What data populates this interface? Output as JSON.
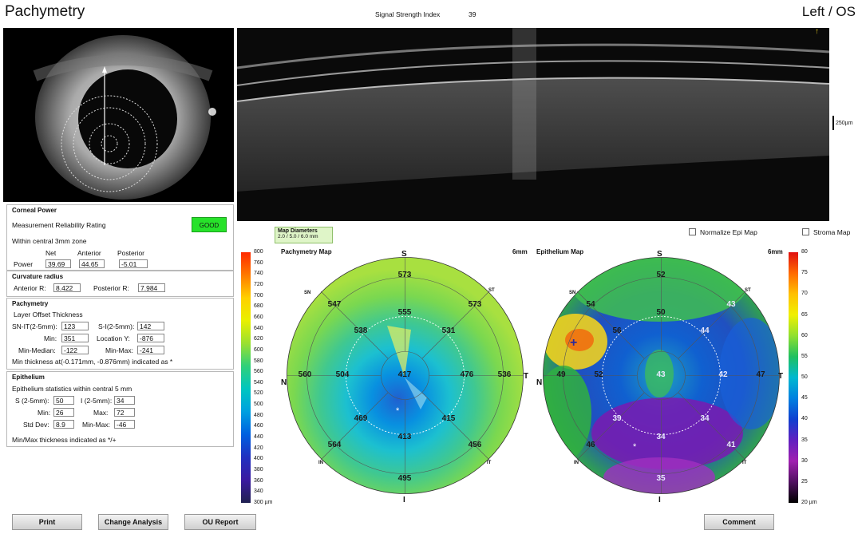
{
  "header": {
    "title": "Pachymetry",
    "signal_label": "Signal Strength Index",
    "signal_value": "39",
    "eye_side": "Left / OS"
  },
  "oct": {
    "scale_label": "250µm"
  },
  "corneal_power": {
    "heading": "Corneal Power",
    "reliability_label": "Measurement Reliability Rating",
    "reliability_value": "GOOD",
    "zone_label": "Within central 3mm zone",
    "col_net": "Net",
    "col_anterior": "Anterior",
    "col_posterior": "Posterior",
    "power_label": "Power",
    "power_net": "39.69",
    "power_anterior": "44.65",
    "power_posterior": "-5.01"
  },
  "curvature": {
    "heading": "Curvature radius",
    "anterior_label": "Anterior R:",
    "anterior_value": "8.422",
    "posterior_label": "Posterior R:",
    "posterior_value": "7.984"
  },
  "pachymetry": {
    "heading": "Pachymetry",
    "tabs": "Layer  Offset  Thickness",
    "snit_label": "SN-IT(2-5mm):",
    "snit_value": "123",
    "si_label": "S-I(2-5mm):",
    "si_value": "142",
    "min_label": "Min:",
    "min_value": "351",
    "locy_label": "Location Y:",
    "locy_value": "-876",
    "minmed_label": "Min-Median:",
    "minmed_value": "-122",
    "minmax_label": "Min-Max:",
    "minmax_value": "-241",
    "note": "Min thickness at(-0.171mm, -0.876mm) indicated as *"
  },
  "epithelium": {
    "heading": "Epithelium",
    "stats_label": "Epithelium statistics within central 5 mm",
    "s_label": "S (2-5mm):",
    "s_value": "50",
    "i_label": "I (2-5mm):",
    "i_value": "34",
    "min_label": "Min:",
    "min_value": "26",
    "max_label": "Max:",
    "max_value": "72",
    "std_label": "Std Dev:",
    "std_value": "8.9",
    "minmax_label": "Min-Max:",
    "minmax_value": "-46",
    "note": "Min/Max thickness indicated as */+"
  },
  "maps": {
    "diam_title": "Map Diameters",
    "diam_values": "2.0 / 5.0 / 6.0 mm",
    "normalize_label": "Normalize Epi Map",
    "stroma_label": "Stroma Map",
    "pachy_title": "Pachymetry Map",
    "pachy_size": "6mm",
    "epi_title": "Epithelium Map",
    "epi_size": "6mm",
    "dir_s": "S",
    "dir_i": "I",
    "dir_n": "N",
    "dir_t": "T",
    "sub_sn": "SN",
    "sub_st": "ST",
    "sub_in": "IN",
    "sub_it": "IT",
    "pachy_values": {
      "s_out": "573",
      "sn_out": "547",
      "st_out": "573",
      "s_mid": "555",
      "sn_mid": "538",
      "st_mid": "531",
      "n_out": "560",
      "n_mid": "504",
      "center": "417",
      "t_mid": "476",
      "t_out": "536",
      "in_mid": "469",
      "it_mid": "415",
      "i_mid": "413",
      "in_out": "564",
      "it_out": "456",
      "i_out": "495"
    },
    "epi_values": {
      "s_out": "52",
      "sn_out": "54",
      "st_out": "43",
      "s_mid": "50",
      "sn_mid": "56",
      "st_mid": "44",
      "n_out": "49",
      "n_mid": "52",
      "center": "43",
      "t_mid": "42",
      "t_out": "47",
      "in_mid": "39",
      "it_mid": "34",
      "i_mid": "34",
      "in_out": "46",
      "it_out": "41",
      "i_out": "35"
    },
    "pachy_scale": [
      "800",
      "760",
      "740",
      "720",
      "700",
      "680",
      "660",
      "640",
      "620",
      "600",
      "580",
      "560",
      "540",
      "520",
      "500",
      "480",
      "460",
      "440",
      "420",
      "400",
      "380",
      "360",
      "340",
      "300 µm"
    ],
    "epi_scale": [
      "80",
      "75",
      "70",
      "65",
      "60",
      "55",
      "50",
      "45",
      "40",
      "35",
      "30",
      "25",
      "20 µm"
    ]
  },
  "buttons": {
    "print": "Print",
    "change": "Change Analysis",
    "ou": "OU Report",
    "comment": "Comment"
  }
}
